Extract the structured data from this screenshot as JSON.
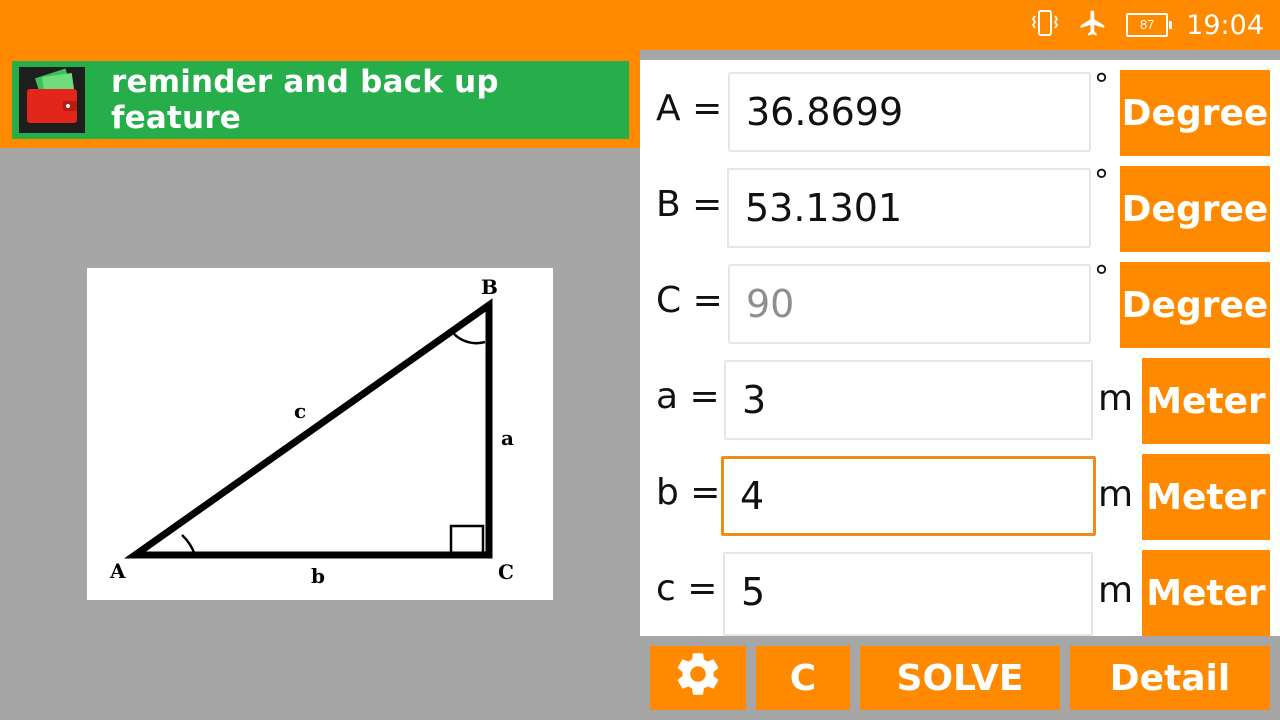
{
  "status_bar": {
    "time": "19:04",
    "battery": "87",
    "icons": [
      "vibrate-icon",
      "airplane-mode-icon",
      "battery-icon"
    ]
  },
  "ad_banner": {
    "text": "reminder and back up feature",
    "logo_icon": "wallet-icon"
  },
  "diagram": {
    "vertex_a": "A",
    "vertex_b": "B",
    "vertex_c": "C",
    "side_a": "a",
    "side_b": "b",
    "side_c": "c"
  },
  "fields": [
    {
      "label": "A =",
      "value": "36.8699",
      "symbol": "°",
      "unit": "Degree",
      "state": "normal"
    },
    {
      "label": "B =",
      "value": "53.1301",
      "symbol": "°",
      "unit": "Degree",
      "state": "normal"
    },
    {
      "label": "C =",
      "value": "90",
      "symbol": "°",
      "unit": "Degree",
      "state": "disabled"
    },
    {
      "label": "a =",
      "value": "3",
      "symbol": "m",
      "unit": "Meter",
      "state": "normal"
    },
    {
      "label": "b =",
      "value": "4",
      "symbol": "m",
      "unit": "Meter",
      "state": "focused"
    },
    {
      "label": "c =",
      "value": "5",
      "symbol": "m",
      "unit": "Meter",
      "state": "normal"
    }
  ],
  "bottom_bar": {
    "settings_icon": "gear-icon",
    "clear_label": "C",
    "solve_label": "SOLVE",
    "detail_label": "Detail"
  },
  "colors": {
    "accent": "#ff8a00",
    "banner": "#25ae4a",
    "background": "#a6a6a6",
    "focus": "#f08a19"
  }
}
